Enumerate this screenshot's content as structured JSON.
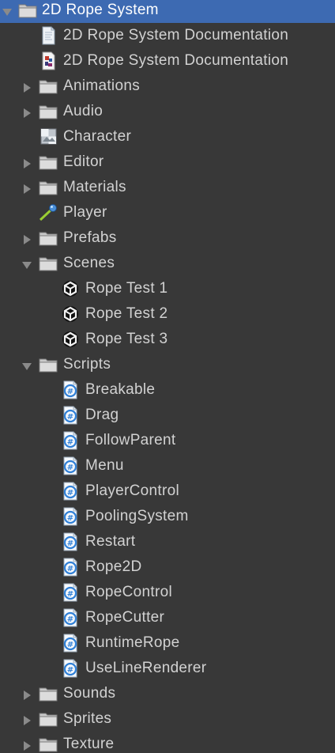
{
  "project_browser": {
    "items": [
      {
        "label": "2D Rope System",
        "icon": "folder-icon",
        "depth": 0,
        "expandable": true,
        "expanded": true,
        "selected": true
      },
      {
        "label": "2D Rope System Documentation",
        "icon": "document-icon",
        "depth": 1,
        "expandable": false
      },
      {
        "label": "2D Rope System Documentation",
        "icon": "document-image-icon",
        "depth": 1,
        "expandable": false
      },
      {
        "label": "Animations",
        "icon": "folder-icon",
        "depth": 1,
        "expandable": true,
        "expanded": false
      },
      {
        "label": "Audio",
        "icon": "folder-icon",
        "depth": 1,
        "expandable": true,
        "expanded": false
      },
      {
        "label": "Character",
        "icon": "texture-icon",
        "depth": 1,
        "expandable": false
      },
      {
        "label": "Editor",
        "icon": "folder-icon",
        "depth": 1,
        "expandable": true,
        "expanded": false
      },
      {
        "label": "Materials",
        "icon": "folder-icon",
        "depth": 1,
        "expandable": true,
        "expanded": false
      },
      {
        "label": "Player",
        "icon": "material-icon",
        "depth": 1,
        "expandable": false
      },
      {
        "label": "Prefabs",
        "icon": "folder-icon",
        "depth": 1,
        "expandable": true,
        "expanded": false
      },
      {
        "label": "Scenes",
        "icon": "folder-icon",
        "depth": 1,
        "expandable": true,
        "expanded": true
      },
      {
        "label": "Rope Test 1",
        "icon": "unity-scene-icon",
        "depth": 2,
        "expandable": false
      },
      {
        "label": "Rope Test 2",
        "icon": "unity-scene-icon",
        "depth": 2,
        "expandable": false
      },
      {
        "label": "Rope Test 3",
        "icon": "unity-scene-icon",
        "depth": 2,
        "expandable": false
      },
      {
        "label": "Scripts",
        "icon": "folder-icon",
        "depth": 1,
        "expandable": true,
        "expanded": true
      },
      {
        "label": "Breakable",
        "icon": "csharp-script-icon",
        "depth": 2,
        "expandable": false
      },
      {
        "label": "Drag",
        "icon": "csharp-script-icon",
        "depth": 2,
        "expandable": false
      },
      {
        "label": "FollowParent",
        "icon": "csharp-script-icon",
        "depth": 2,
        "expandable": false
      },
      {
        "label": "Menu",
        "icon": "csharp-script-icon",
        "depth": 2,
        "expandable": false
      },
      {
        "label": "PlayerControl",
        "icon": "csharp-script-icon",
        "depth": 2,
        "expandable": false
      },
      {
        "label": "PoolingSystem",
        "icon": "csharp-script-icon",
        "depth": 2,
        "expandable": false
      },
      {
        "label": "Restart",
        "icon": "csharp-script-icon",
        "depth": 2,
        "expandable": false
      },
      {
        "label": "Rope2D",
        "icon": "csharp-script-icon",
        "depth": 2,
        "expandable": false
      },
      {
        "label": "RopeControl",
        "icon": "csharp-script-icon",
        "depth": 2,
        "expandable": false
      },
      {
        "label": "RopeCutter",
        "icon": "csharp-script-icon",
        "depth": 2,
        "expandable": false
      },
      {
        "label": "RuntimeRope",
        "icon": "csharp-script-icon",
        "depth": 2,
        "expandable": false
      },
      {
        "label": "UseLineRenderer",
        "icon": "csharp-script-icon",
        "depth": 2,
        "expandable": false
      },
      {
        "label": "Sounds",
        "icon": "folder-icon",
        "depth": 1,
        "expandable": true,
        "expanded": false
      },
      {
        "label": "Sprites",
        "icon": "folder-icon",
        "depth": 1,
        "expandable": true,
        "expanded": false
      },
      {
        "label": "Texture",
        "icon": "folder-icon",
        "depth": 1,
        "expandable": true,
        "expanded": false
      }
    ]
  },
  "colors": {
    "background": "#383838",
    "selection": "#3d6ab2",
    "text": "#d2d2d2",
    "selected_text": "#ffffff",
    "arrow": "#8a8a8a",
    "folder": "#c9c9c9",
    "script_blue": "#2f7fd6"
  }
}
